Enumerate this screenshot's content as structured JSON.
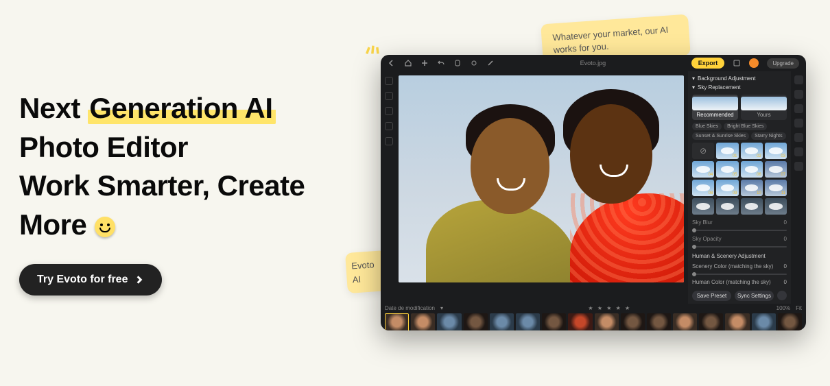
{
  "hero": {
    "line1a": "Next ",
    "line1b": "Generation AI",
    "line2": "Photo Editor",
    "line3": "Work Smarter, Create",
    "line4": "More ",
    "cta": "Try Evoto for free"
  },
  "notes": {
    "n1": "Whatever your market, our AI works for you.",
    "n2a": "Evoto",
    "n2b": "AI"
  },
  "app": {
    "filename": "Evoto.jpg",
    "export": "Export",
    "upgrade": "Upgrade",
    "date_label": "Date de modification",
    "zoom": "100%",
    "fit": "Fit",
    "panel": {
      "header": "Background Adjustment",
      "section": "Sky Replacement",
      "tab_rec": "Recommended",
      "tab_yours": "Yours",
      "chips": [
        "Blue Skies",
        "Bright Blue Skies",
        "Sunset & Sunrise Skies",
        "Starry Nights"
      ],
      "none": "None",
      "ids": [
        "01",
        "02",
        "03",
        "04",
        "05",
        "06",
        "07",
        "08",
        "09",
        "10",
        "11"
      ],
      "slider1": "Sky Blur",
      "slider1_v": "0",
      "slider2": "Sky Opacity",
      "slider2_v": "0",
      "sec2": "Human & Scenery Adjustment",
      "row1": "Scenery Color (matching the sky)",
      "row1_v": "0",
      "row2": "Human Color (matching the sky)",
      "row2_v": "0",
      "save": "Save Preset",
      "sync": "Sync Settings"
    }
  }
}
